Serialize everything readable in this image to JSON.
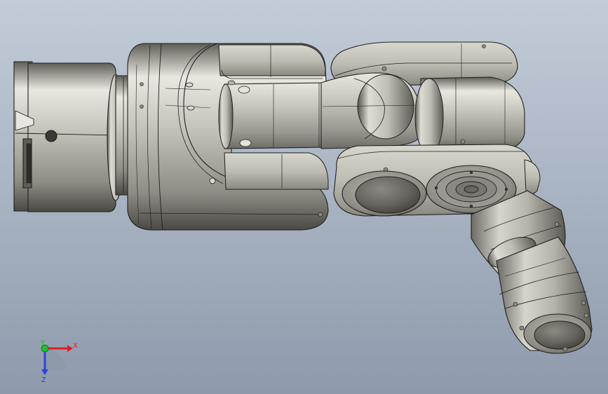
{
  "scene": {
    "background_top": "#c3ccd8",
    "background_bottom": "#8e9aac",
    "model_color": "#c9c8bf",
    "edge_color": "#1f1f1f"
  },
  "triad": {
    "x_label": "X",
    "y_label": "Y",
    "z_label": "Z",
    "x_color": "#e31b23",
    "y_color": "#1fbf2b",
    "z_color": "#2b44d6"
  }
}
